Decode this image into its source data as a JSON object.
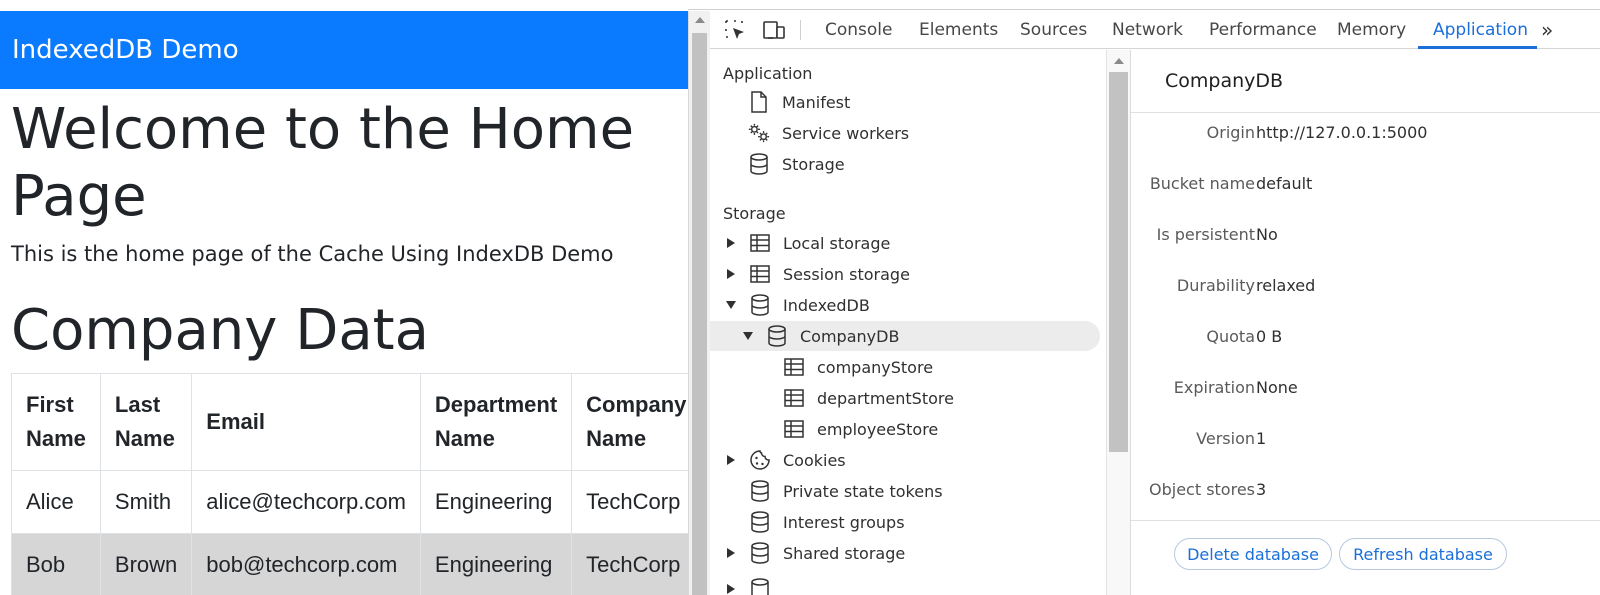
{
  "page": {
    "navbar_brand": "IndexedDB Demo",
    "heading": "Welcome to the Home Page",
    "lead": "This is the home page of the Cache Using IndexDB Demo",
    "section_title": "Company Data",
    "table": {
      "headers": [
        "First Name",
        "Last Name",
        "Email",
        "Department Name",
        "Company Name"
      ],
      "rows": [
        [
          "Alice",
          "Smith",
          "alice@techcorp.com",
          "Engineering",
          "TechCorp"
        ],
        [
          "Bob",
          "Brown",
          "bob@techcorp.com",
          "Engineering",
          "TechCorp"
        ]
      ]
    }
  },
  "devtools": {
    "toolbar_icons": [
      "inspect-element-icon",
      "device-toolbar-icon"
    ],
    "tabs": [
      "Console",
      "Elements",
      "Sources",
      "Network",
      "Performance",
      "Memory",
      "Application"
    ],
    "active_tab": "Application",
    "more_tabs_glyph": "»",
    "sidebar": {
      "application_section": "Application",
      "application_items": [
        "Manifest",
        "Service workers",
        "Storage"
      ],
      "storage_section": "Storage",
      "storage_items": [
        {
          "label": "Local storage",
          "icon": "table-icon",
          "expander": "collapsed"
        },
        {
          "label": "Session storage",
          "icon": "table-icon",
          "expander": "collapsed"
        },
        {
          "label": "IndexedDB",
          "icon": "database-icon",
          "expander": "expanded"
        },
        {
          "label": "CompanyDB",
          "icon": "database-icon",
          "expander": "expanded",
          "selected": true
        },
        {
          "label": "companyStore",
          "icon": "table-icon",
          "expander": "none"
        },
        {
          "label": "departmentStore",
          "icon": "table-icon",
          "expander": "none"
        },
        {
          "label": "employeeStore",
          "icon": "table-icon",
          "expander": "none"
        },
        {
          "label": "Cookies",
          "icon": "cookie-icon",
          "expander": "collapsed"
        },
        {
          "label": "Private state tokens",
          "icon": "database-icon",
          "expander": "none"
        },
        {
          "label": "Interest groups",
          "icon": "database-icon",
          "expander": "none"
        },
        {
          "label": "Shared storage",
          "icon": "database-icon",
          "expander": "collapsed"
        }
      ]
    },
    "details": {
      "title": "CompanyDB",
      "fields": [
        {
          "label": "Origin",
          "value": "http://127.0.0.1:5000"
        },
        {
          "label": "Bucket name",
          "value": "default"
        },
        {
          "label": "Is persistent",
          "value": "No"
        },
        {
          "label": "Durability",
          "value": "relaxed"
        },
        {
          "label": "Quota",
          "value": "0 B"
        },
        {
          "label": "Expiration",
          "value": "None"
        },
        {
          "label": "Version",
          "value": "1"
        },
        {
          "label": "Object stores",
          "value": "3"
        }
      ],
      "delete_button": "Delete database",
      "refresh_button": "Refresh database"
    }
  },
  "colors": {
    "navbar_bg": "#0a7bff",
    "devtools_accent": "#1a6fd8",
    "striped_row": "#d6d6d6"
  }
}
